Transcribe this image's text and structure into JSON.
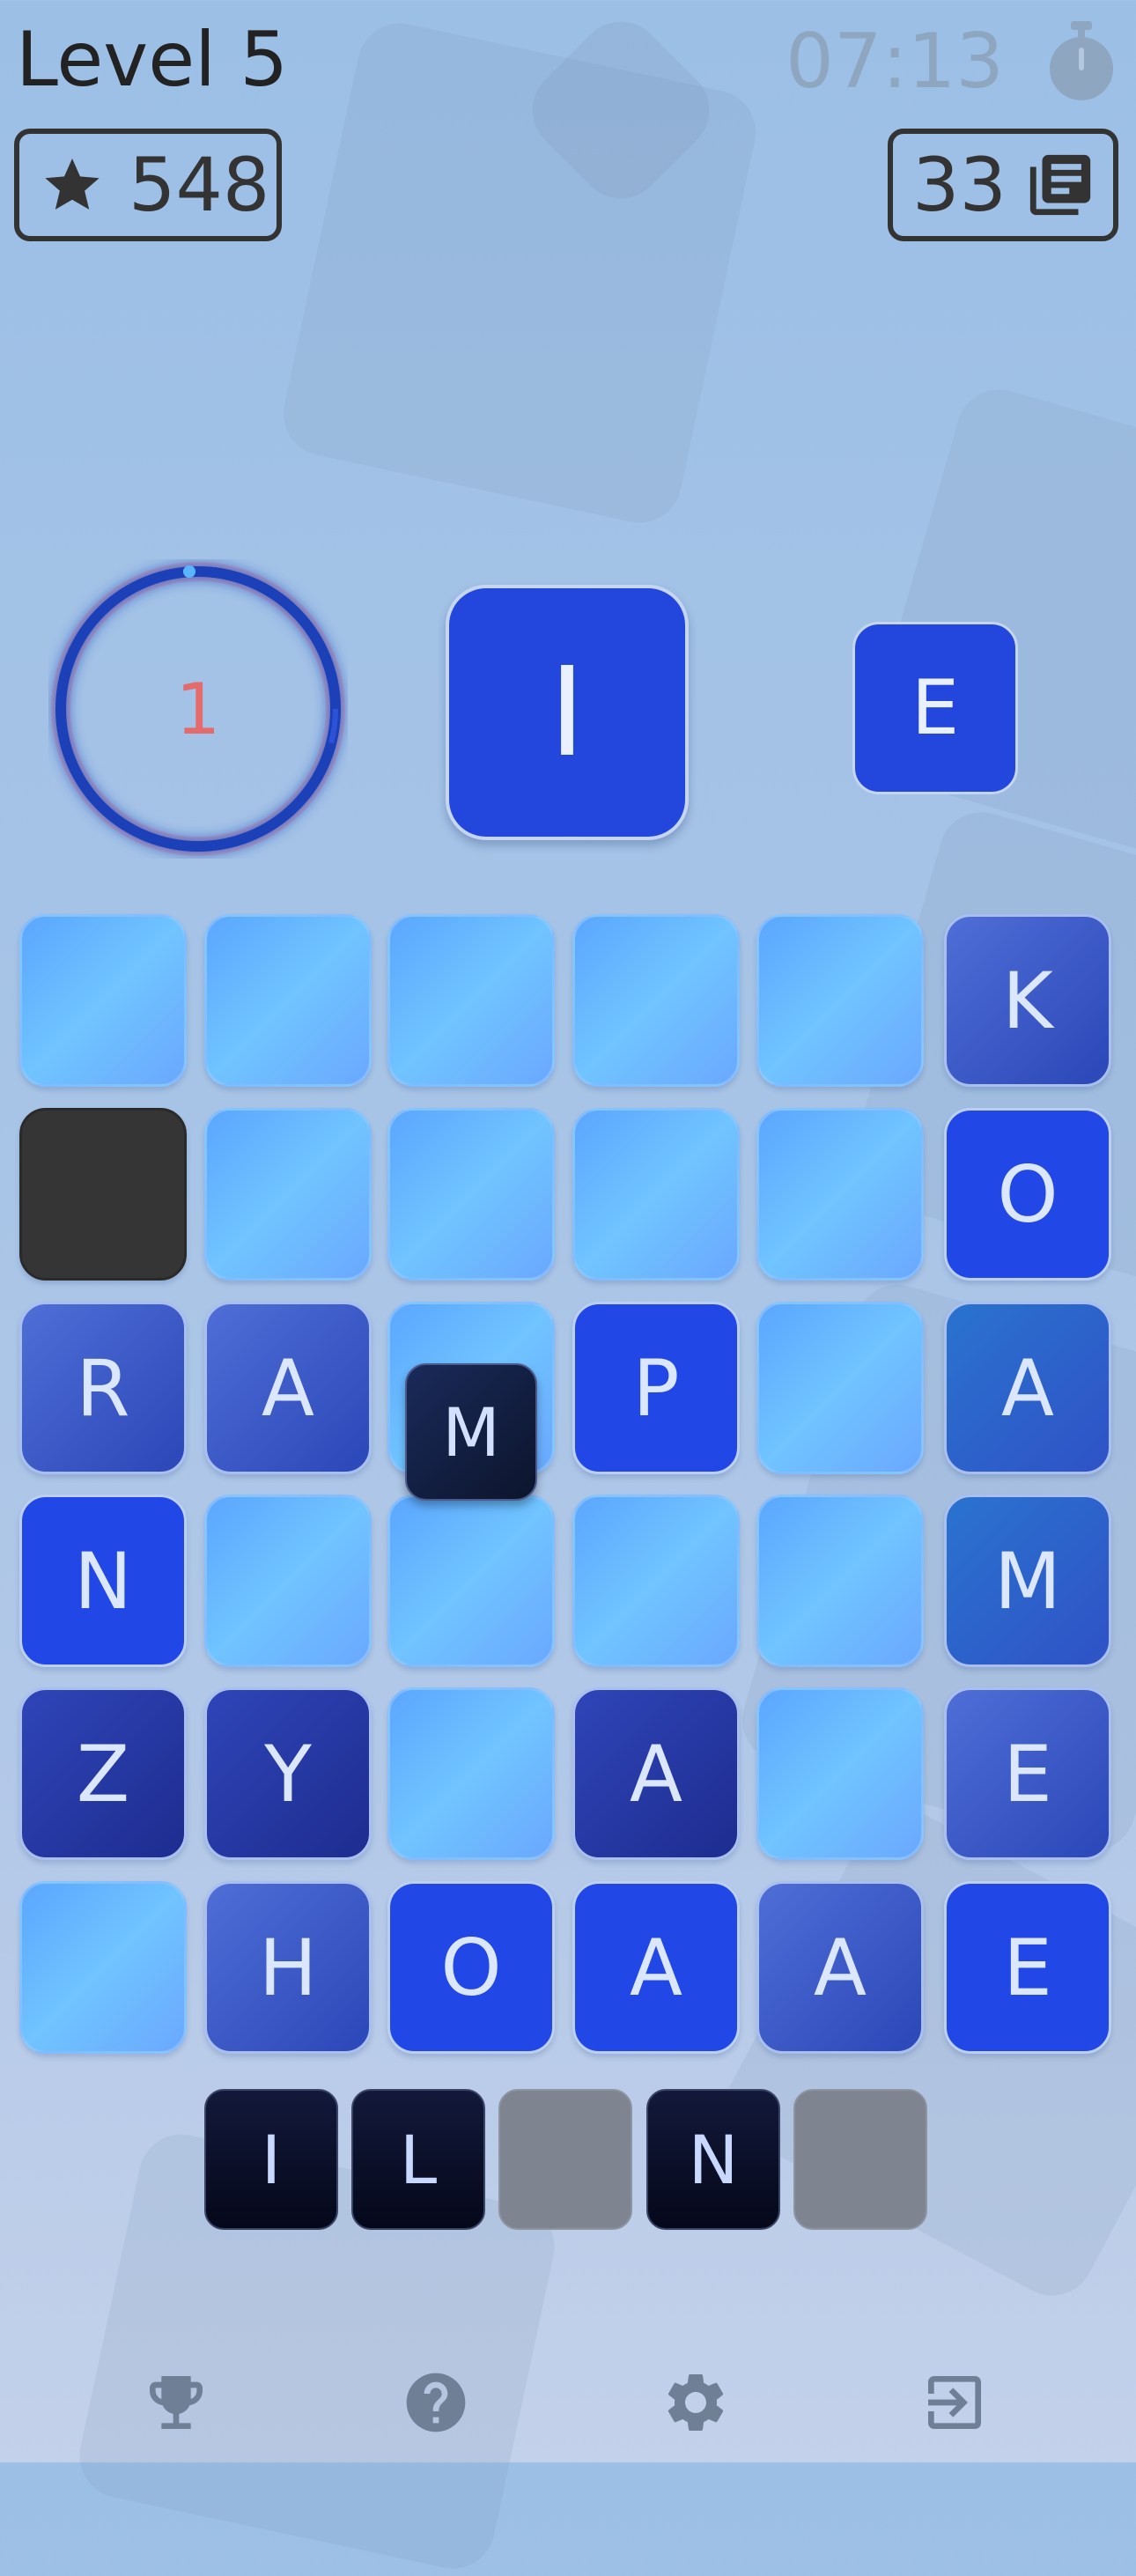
{
  "header": {
    "level_title": "Level 5",
    "timer": "07:13",
    "stars": "548",
    "cards": "33"
  },
  "current": {
    "counter": "1",
    "letter": "I",
    "next_letter": "E"
  },
  "grid": [
    [
      "",
      "",
      "",
      "",
      "",
      "K"
    ],
    [
      "",
      "",
      "",
      "",
      "",
      "O"
    ],
    [
      "R",
      "A",
      "",
      "P",
      "",
      "A"
    ],
    [
      "N",
      "",
      "",
      "",
      "",
      "M"
    ],
    [
      "Z",
      "Y",
      "",
      "A",
      "",
      "E"
    ],
    [
      "",
      "H",
      "O",
      "A",
      "A",
      "E"
    ]
  ],
  "grid_styles": [
    [
      "empty",
      "empty",
      "empty",
      "empty",
      "empty",
      "mid"
    ],
    [
      "black",
      "empty",
      "empty",
      "empty",
      "empty",
      "bright"
    ],
    [
      "mid",
      "mid",
      "empty",
      "bright",
      "empty",
      "teal"
    ],
    [
      "bright",
      "empty",
      "empty",
      "empty",
      "empty",
      "teal"
    ],
    [
      "dark",
      "dark",
      "empty",
      "dark",
      "empty",
      "mid"
    ],
    [
      "empty",
      "mid",
      "bright",
      "bright",
      "mid",
      "bright"
    ]
  ],
  "floating_tile": "M",
  "word_slots": [
    "I",
    "L",
    "",
    "N",
    ""
  ],
  "bottom_nav": [
    "trophy-icon",
    "help-icon",
    "settings-icon",
    "exit-icon"
  ],
  "colors": {
    "accent": "#2346dc",
    "counter_red": "#e36b6b",
    "ring_blue": "#1f3fb8"
  }
}
